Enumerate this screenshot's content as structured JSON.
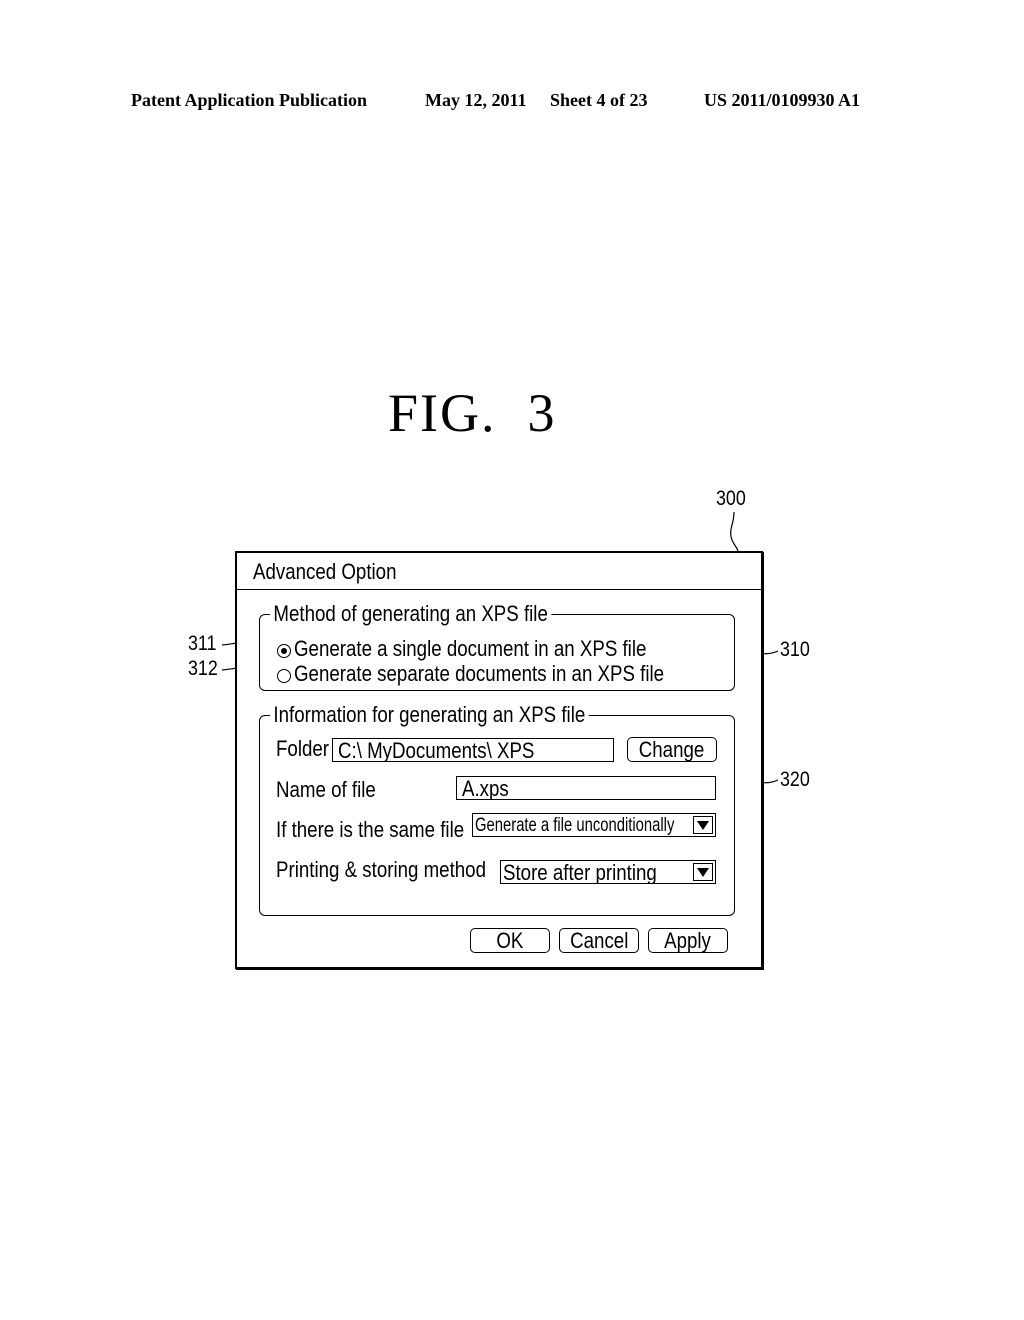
{
  "header": {
    "publication": "Patent Application Publication",
    "date": "May 12, 2011",
    "sheet": "Sheet 4 of 23",
    "number": "US 2011/0109930 A1"
  },
  "figure": {
    "title": "FIG.  3"
  },
  "reference_numerals": {
    "dialog": "300",
    "method_group": "310",
    "info_group": "320",
    "radio_single": "311",
    "radio_separate": "312"
  },
  "dialog": {
    "title": "Advanced Option",
    "method_group": {
      "label": "Method of generating an XPS file",
      "options": [
        {
          "label": "Generate a single document in an XPS file",
          "checked": true
        },
        {
          "label": "Generate separate documents in an XPS file",
          "checked": false
        }
      ]
    },
    "info_group": {
      "label": "Information for generating an XPS file",
      "folder_label": "Folder",
      "folder_value": "C:\\ MyDocuments\\ XPS",
      "change_button": "Change",
      "name_label": "Name of file",
      "name_value": "A.xps",
      "same_file_label": "If there is the same file",
      "same_file_value": "Generate a file unconditionally",
      "method_label": "Printing & storing method",
      "method_value": "Store after printing"
    },
    "buttons": {
      "ok": "OK",
      "cancel": "Cancel",
      "apply": "Apply"
    }
  }
}
